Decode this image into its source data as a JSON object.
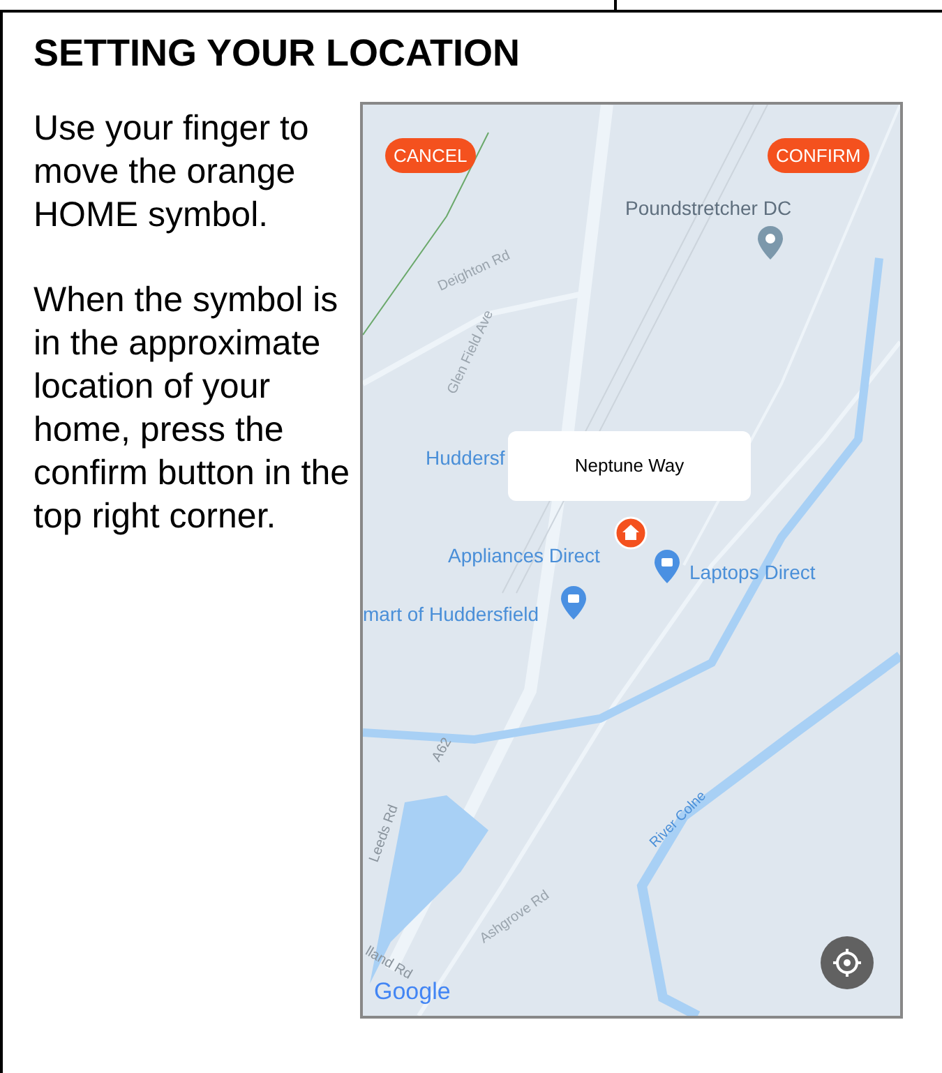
{
  "heading": "SETTING YOUR LOCATION",
  "paragraphs": [
    "Use your finger to move the orange HOME symbol.",
    "When the symbol is in the approximate location of your home, press the confirm button in the top right corner."
  ],
  "map": {
    "cancel_button": "CANCEL",
    "confirm_button": "CONFIRM",
    "popup": "Neptune Way",
    "attribution": "Google",
    "places": [
      {
        "kind": "plain",
        "label": "Poundstretcher DC"
      },
      {
        "kind": "blue",
        "label": "Huddersf"
      },
      {
        "kind": "blue",
        "label": "Appliances Direct"
      },
      {
        "kind": "shop",
        "label": "Laptops Direct"
      },
      {
        "kind": "shop",
        "label": "mart of Huddersfield"
      }
    ],
    "roads": [
      "Deighton Rd",
      "Glen Field Ave",
      "A62",
      "Leeds Rd",
      "River Colne",
      "Ashgrove Rd",
      "lland Rd"
    ]
  }
}
